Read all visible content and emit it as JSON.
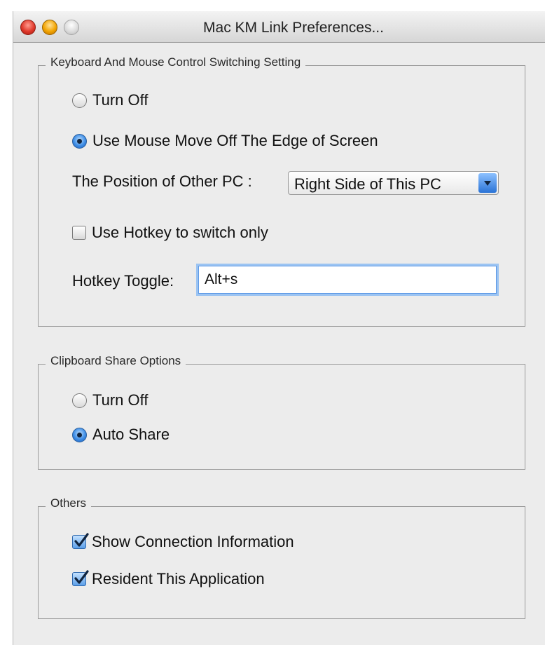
{
  "window": {
    "title": "Mac KM Link Preferences...",
    "controls": [
      "close",
      "minimize",
      "zoom"
    ]
  },
  "switching": {
    "legend": "Keyboard And Mouse Control Switching Setting",
    "turn_off_label": "Turn Off",
    "turn_off_selected": false,
    "mouse_edge_label": "Use Mouse Move Off The Edge of Screen",
    "mouse_edge_selected": true,
    "position_label": "The Position of Other PC :",
    "position_value": "Right Side of This PC",
    "hotkey_only_label": "Use Hotkey to switch only",
    "hotkey_only_checked": false,
    "hotkey_toggle_label": "Hotkey Toggle:",
    "hotkey_toggle_value": "Alt+s"
  },
  "clipboard": {
    "legend": "Clipboard Share Options",
    "turn_off_label": "Turn Off",
    "turn_off_selected": false,
    "auto_share_label": "Auto Share",
    "auto_share_selected": true
  },
  "others": {
    "legend": "Others",
    "show_connection_label": "Show Connection Information",
    "show_connection_checked": true,
    "resident_label": "Resident This Application",
    "resident_checked": true
  },
  "colors": {
    "accent": "#3f8ee6",
    "window_bg": "#ececec",
    "close": "#e0392b",
    "minimize": "#f2a400",
    "zoom_inactive": "#d9d9d9"
  }
}
